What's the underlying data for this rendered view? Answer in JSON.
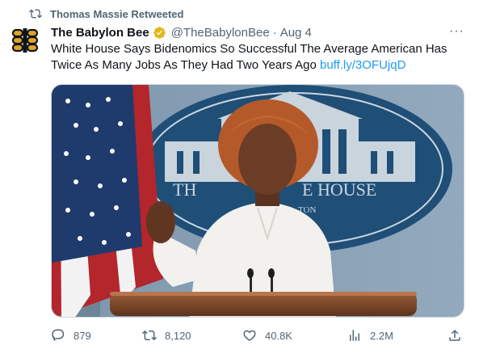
{
  "retweet": {
    "text": "Thomas Massie Retweeted",
    "icon": "retweet-icon"
  },
  "author": {
    "name": "The Babylon Bee",
    "handle": "@TheBabylonBee",
    "separator": "·",
    "date": "Aug 4",
    "verified_color": "#e2b719",
    "avatar_icon": "bee-logo-icon"
  },
  "more_label": "···",
  "tweet": {
    "text": "White House Says Bidenomics So Successful The Average American Has Twice As Many Jobs As They Had Two Years Ago",
    "link": "buff.ly/3OFUjqD",
    "link_color": "#1d9bf0"
  },
  "media": {
    "sign_text_left": "TH",
    "sign_text_right": "E HOUSE",
    "sign_text_small": "TON"
  },
  "actions": {
    "reply_count": "879",
    "retweet_count": "8,120",
    "like_count": "40.8K",
    "view_count": "2.2M"
  }
}
